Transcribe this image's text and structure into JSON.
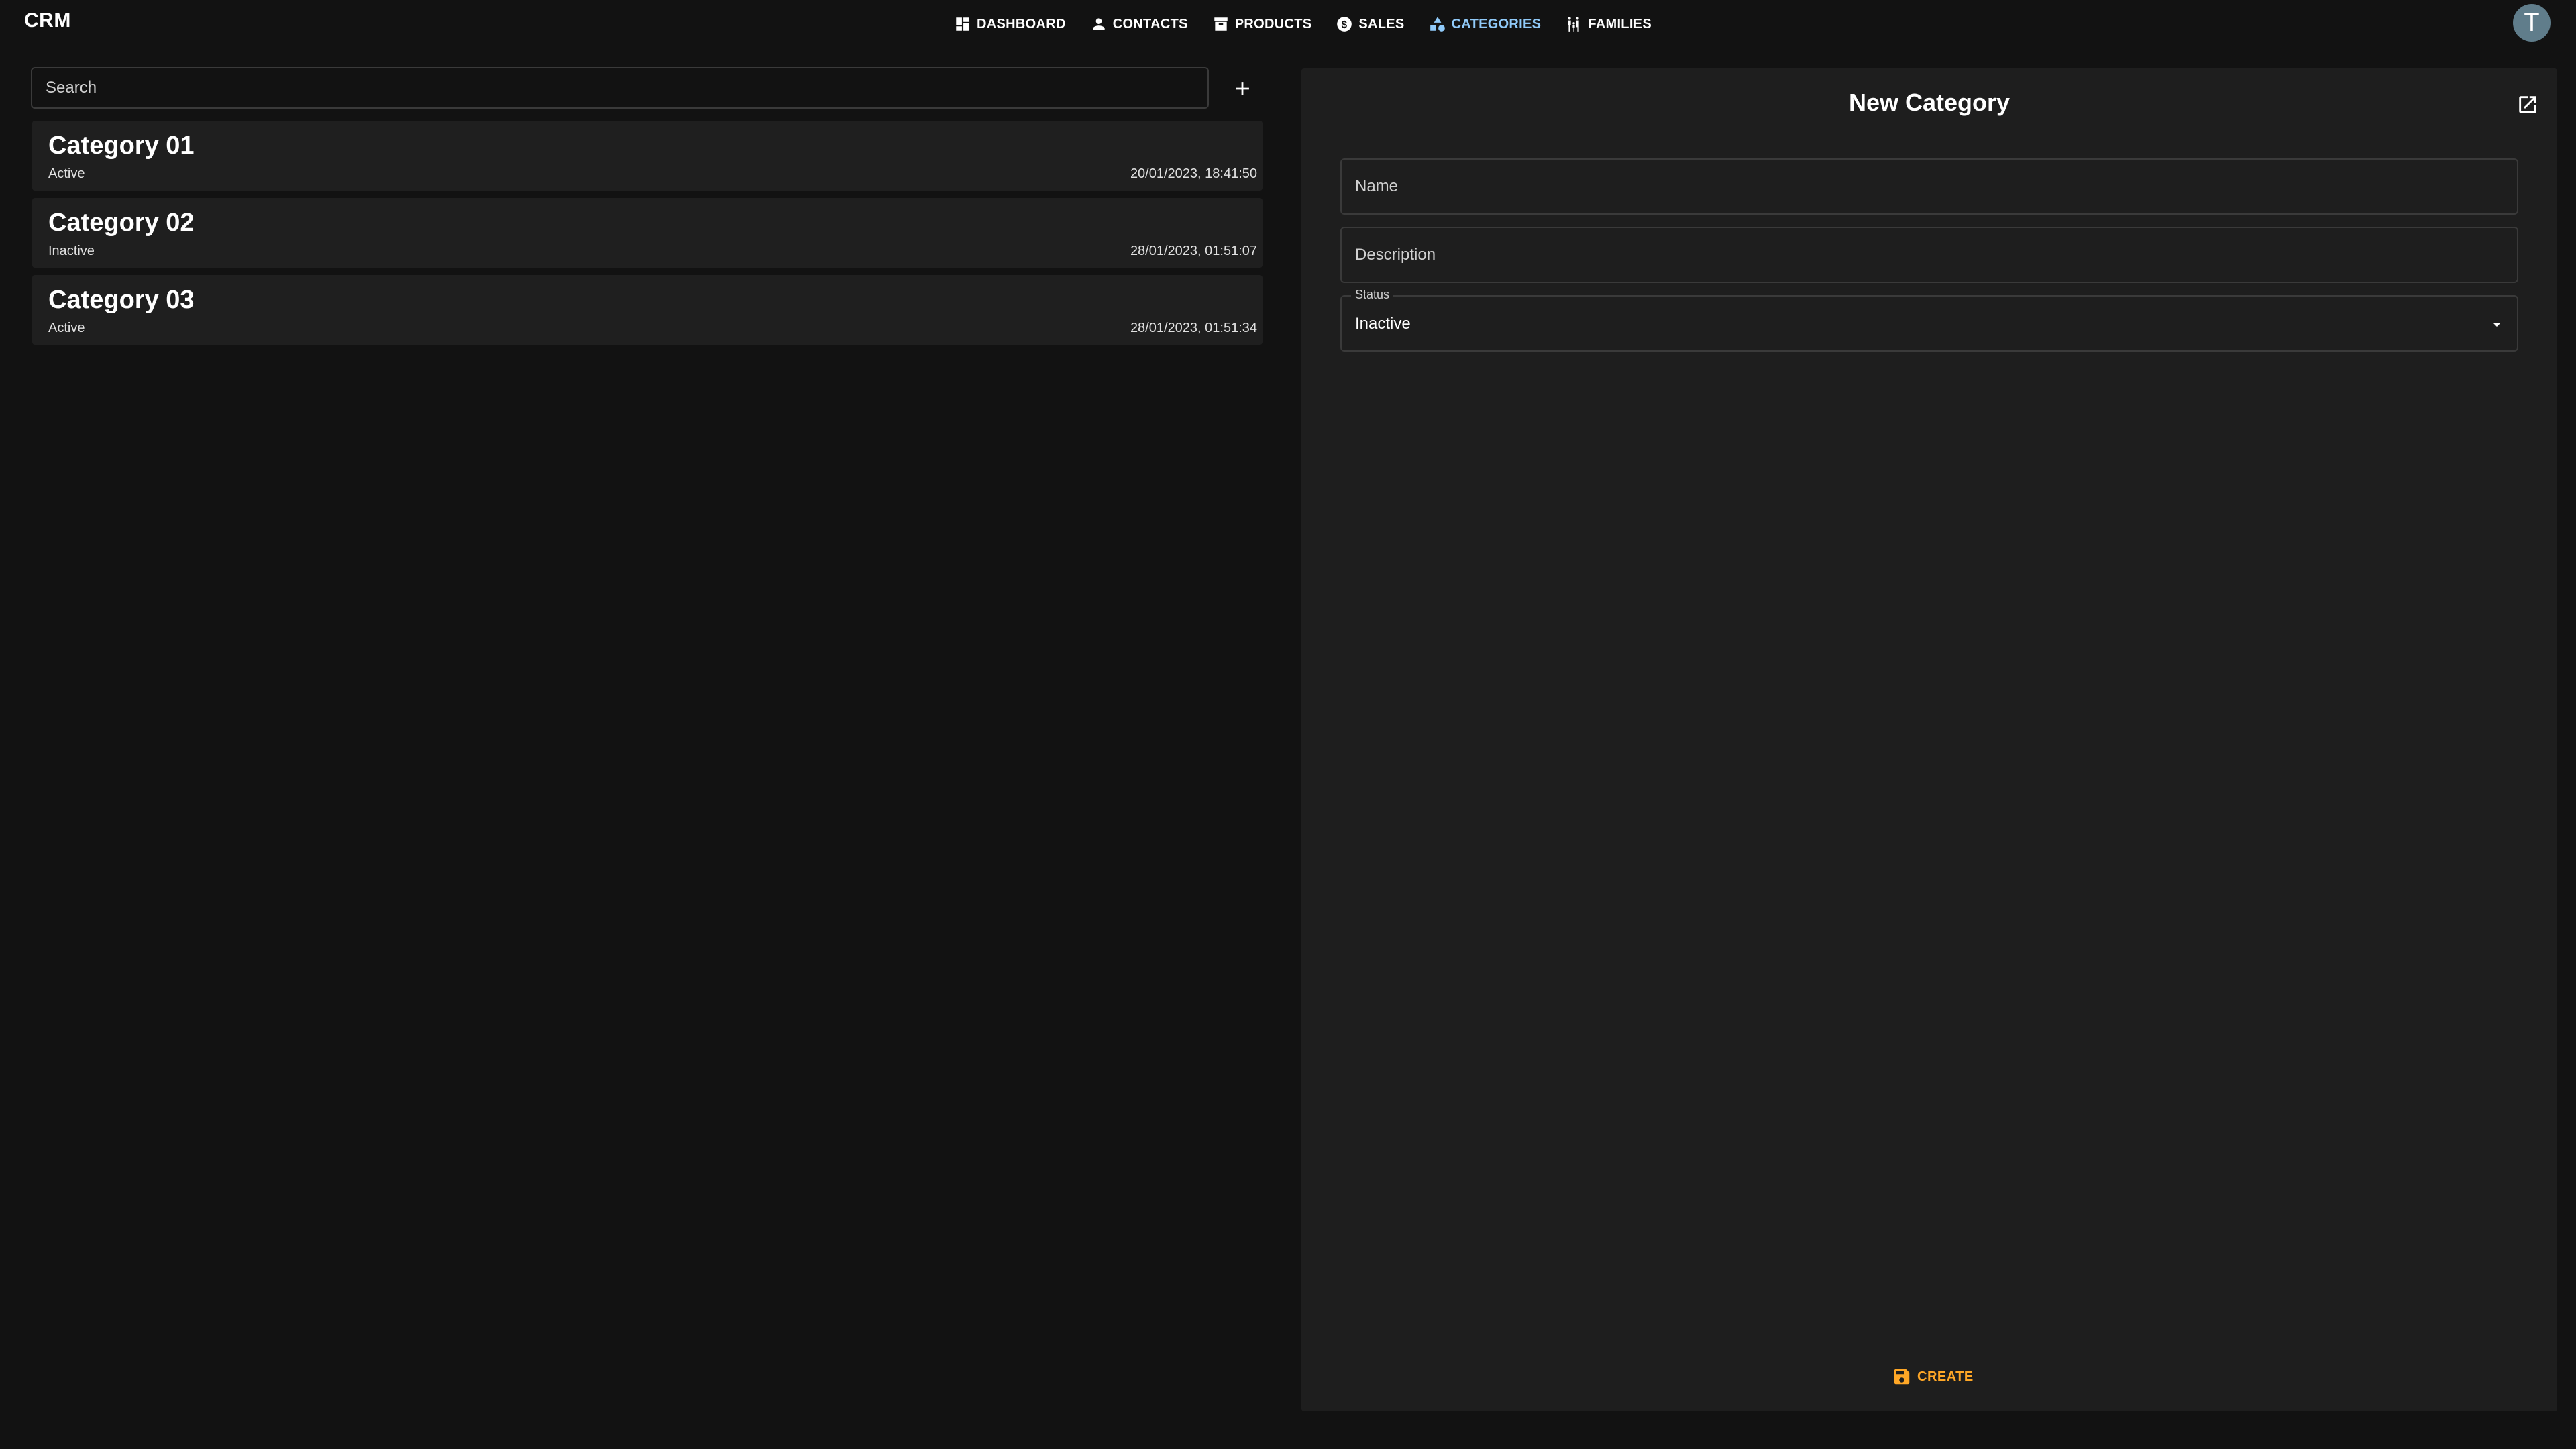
{
  "app": {
    "title": "CRM"
  },
  "nav": {
    "items": [
      {
        "label": "DASHBOARD",
        "icon": "dashboard-icon"
      },
      {
        "label": "CONTACTS",
        "icon": "person-icon"
      },
      {
        "label": "PRODUCTS",
        "icon": "archive-box-icon"
      },
      {
        "label": "SALES",
        "icon": "dollar-circle-icon"
      },
      {
        "label": "CATEGORIES",
        "icon": "category-shapes-icon",
        "active": true
      },
      {
        "label": "FAMILIES",
        "icon": "family-icon"
      }
    ],
    "active_color": "#90caf9"
  },
  "user": {
    "avatar_letter": "T",
    "avatar_color": "#607d8b"
  },
  "list": {
    "search": {
      "placeholder": "Search",
      "value": ""
    },
    "add_icon": "plus-icon",
    "items": [
      {
        "title": "Category 01",
        "status": "Active",
        "date": "20/01/2023, 18:41:50"
      },
      {
        "title": "Category 02",
        "status": "Inactive",
        "date": "28/01/2023, 01:51:07"
      },
      {
        "title": "Category 03",
        "status": "Active",
        "date": "28/01/2023, 01:51:34"
      }
    ]
  },
  "form": {
    "title": "New Category",
    "open_icon": "open-in-new-icon",
    "name": {
      "placeholder": "Name",
      "value": ""
    },
    "description": {
      "placeholder": "Description",
      "value": ""
    },
    "status": {
      "label": "Status",
      "value": "Inactive"
    },
    "create": {
      "label": "CREATE",
      "icon": "save-icon",
      "color": "#ffa726"
    }
  }
}
